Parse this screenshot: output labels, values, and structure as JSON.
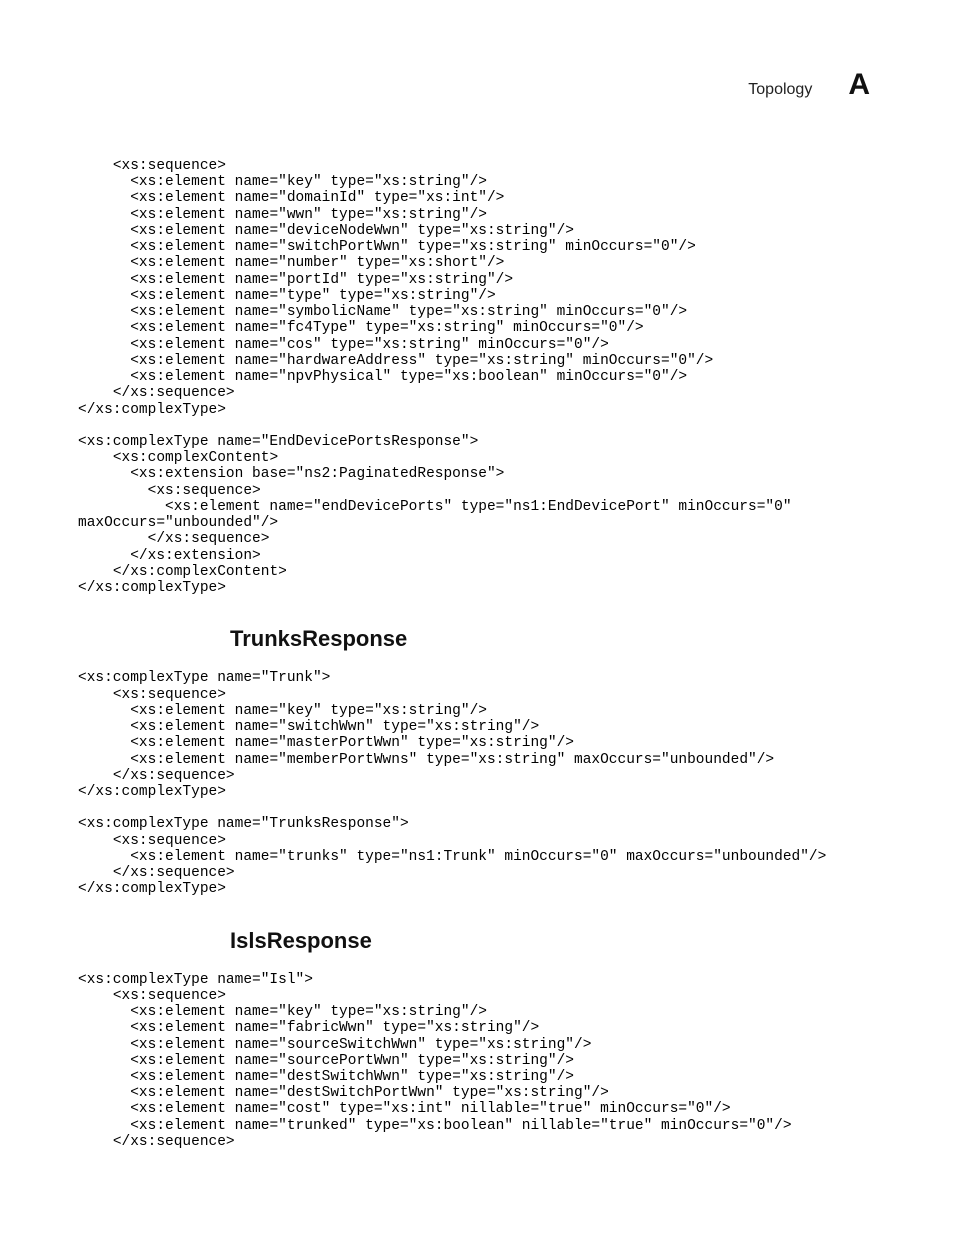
{
  "header": {
    "section": "Topology",
    "letter": "A"
  },
  "code_block_1": "    <xs:sequence>\n      <xs:element name=\"key\" type=\"xs:string\"/>\n      <xs:element name=\"domainId\" type=\"xs:int\"/>\n      <xs:element name=\"wwn\" type=\"xs:string\"/>\n      <xs:element name=\"deviceNodeWwn\" type=\"xs:string\"/>\n      <xs:element name=\"switchPortWwn\" type=\"xs:string\" minOccurs=\"0\"/>\n      <xs:element name=\"number\" type=\"xs:short\"/>\n      <xs:element name=\"portId\" type=\"xs:string\"/>\n      <xs:element name=\"type\" type=\"xs:string\"/>\n      <xs:element name=\"symbolicName\" type=\"xs:string\" minOccurs=\"0\"/>\n      <xs:element name=\"fc4Type\" type=\"xs:string\" minOccurs=\"0\"/>\n      <xs:element name=\"cos\" type=\"xs:string\" minOccurs=\"0\"/>\n      <xs:element name=\"hardwareAddress\" type=\"xs:string\" minOccurs=\"0\"/>\n      <xs:element name=\"npvPhysical\" type=\"xs:boolean\" minOccurs=\"0\"/>\n    </xs:sequence>\n</xs:complexType>\n\n<xs:complexType name=\"EndDevicePortsResponse\">\n    <xs:complexContent>\n      <xs:extension base=\"ns2:PaginatedResponse\">\n        <xs:sequence>\n          <xs:element name=\"endDevicePorts\" type=\"ns1:EndDevicePort\" minOccurs=\"0\" maxOccurs=\"unbounded\"/>\n        </xs:sequence>\n      </xs:extension>\n    </xs:complexContent>\n</xs:complexType>",
  "heading_1": "TrunksResponse",
  "code_block_2": "<xs:complexType name=\"Trunk\">\n    <xs:sequence>\n      <xs:element name=\"key\" type=\"xs:string\"/>\n      <xs:element name=\"switchWwn\" type=\"xs:string\"/>\n      <xs:element name=\"masterPortWwn\" type=\"xs:string\"/>\n      <xs:element name=\"memberPortWwns\" type=\"xs:string\" maxOccurs=\"unbounded\"/>\n    </xs:sequence>\n</xs:complexType>\n\n<xs:complexType name=\"TrunksResponse\">\n    <xs:sequence>\n      <xs:element name=\"trunks\" type=\"ns1:Trunk\" minOccurs=\"0\" maxOccurs=\"unbounded\"/>\n    </xs:sequence>\n</xs:complexType>",
  "heading_2": "IslsResponse",
  "code_block_3": "<xs:complexType name=\"Isl\">\n    <xs:sequence>\n      <xs:element name=\"key\" type=\"xs:string\"/>\n      <xs:element name=\"fabricWwn\" type=\"xs:string\"/>\n      <xs:element name=\"sourceSwitchWwn\" type=\"xs:string\"/>\n      <xs:element name=\"sourcePortWwn\" type=\"xs:string\"/>\n      <xs:element name=\"destSwitchWwn\" type=\"xs:string\"/>\n      <xs:element name=\"destSwitchPortWwn\" type=\"xs:string\"/>\n      <xs:element name=\"cost\" type=\"xs:int\" nillable=\"true\" minOccurs=\"0\"/>\n      <xs:element name=\"trunked\" type=\"xs:boolean\" nillable=\"true\" minOccurs=\"0\"/>\n    </xs:sequence>"
}
